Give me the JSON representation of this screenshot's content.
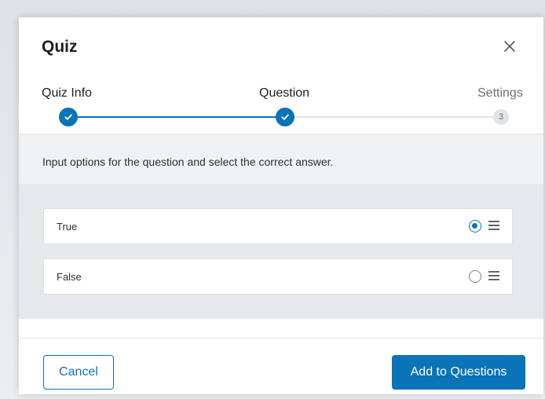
{
  "modal": {
    "title": "Quiz",
    "close_icon": "close-icon"
  },
  "stepper": {
    "steps": [
      {
        "label": "Quiz Info",
        "state": "complete",
        "icon": "check-icon"
      },
      {
        "label": "Question",
        "state": "current",
        "icon": "check-icon"
      },
      {
        "label": "Settings",
        "state": "pending",
        "number": "3"
      }
    ]
  },
  "instruction": "Input options for the question and select the correct answer.",
  "options": [
    {
      "label": "True",
      "selected": true
    },
    {
      "label": "False",
      "selected": false
    }
  ],
  "footer": {
    "cancel_label": "Cancel",
    "add_label": "Add to Questions"
  },
  "colors": {
    "accent": "#0b73b7",
    "track_pending": "#e1e4e7",
    "options_bg": "#e6e8eb"
  }
}
